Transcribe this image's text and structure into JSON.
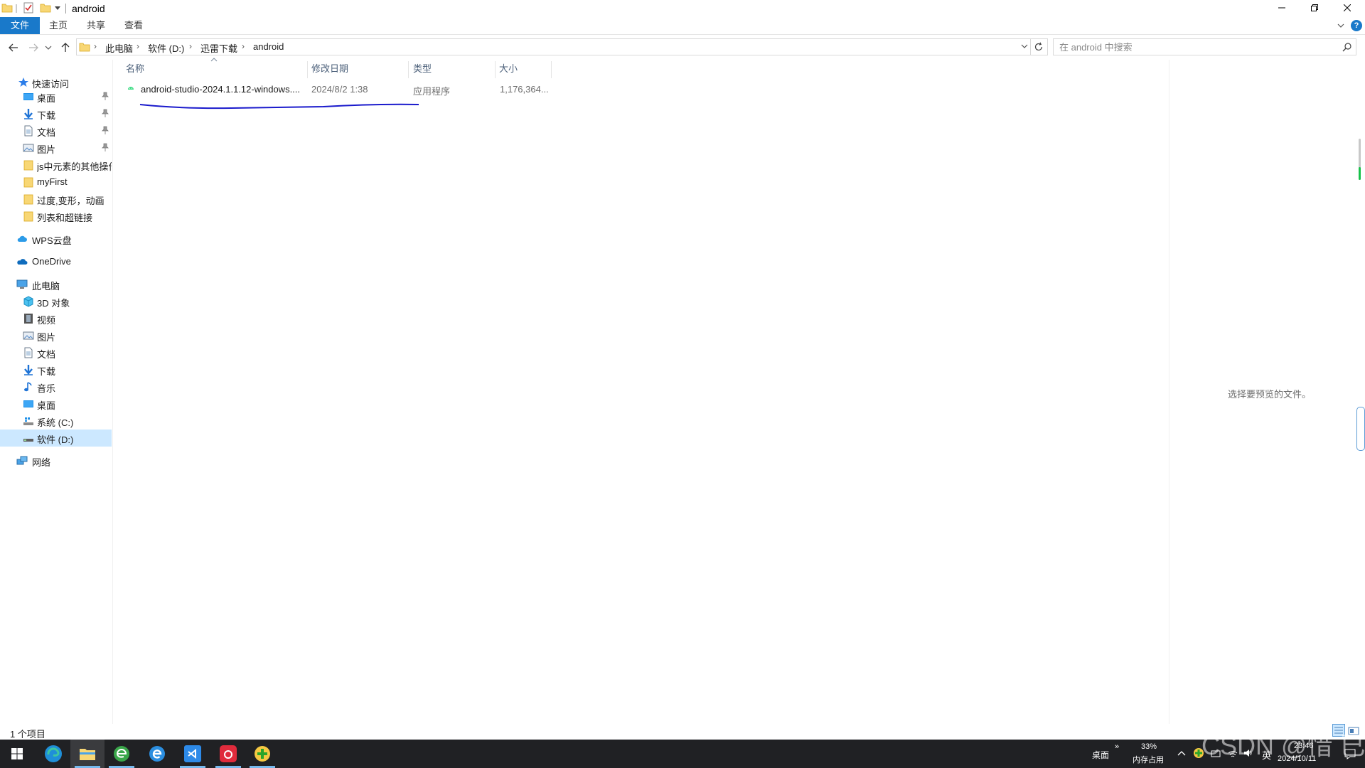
{
  "window": {
    "title": "android"
  },
  "ribbon": {
    "tabs": [
      "文件",
      "主页",
      "共享",
      "查看"
    ]
  },
  "address": {
    "crumbs": [
      "此电脑",
      "软件 (D:)",
      "迅雷下载",
      "android"
    ]
  },
  "search": {
    "placeholder": "在 android 中搜索"
  },
  "sidebar": {
    "quick_access": "快速访问",
    "quick_items": [
      "桌面",
      "下载",
      "文档",
      "图片",
      "js中元素的其他操作",
      "myFirst",
      "过度,变形，动画",
      "列表和超链接"
    ],
    "wps": "WPS云盘",
    "onedrive": "OneDrive",
    "this_pc": "此电脑",
    "pc_items": [
      "3D 对象",
      "视频",
      "图片",
      "文档",
      "下载",
      "音乐",
      "桌面",
      "系统 (C:)",
      "软件 (D:)"
    ],
    "network": "网络"
  },
  "columns": [
    "名称",
    "修改日期",
    "类型",
    "大小"
  ],
  "files": [
    {
      "name": "android-studio-2024.1.1.12-windows....",
      "date": "2024/8/2 1:38",
      "type": "应用程序",
      "size": "1,176,364..."
    }
  ],
  "preview": {
    "empty_text": "选择要预览的文件。"
  },
  "status": {
    "count": "1 个项目"
  },
  "taskbar": {
    "desktop_label": "桌面",
    "mem_percent": "33%",
    "mem_label": "内存占用",
    "ime": "英",
    "time": "23:46",
    "date": "2024/10/11",
    "watermark": "CSDN @惜 已"
  },
  "colors": {
    "accent": "#1979ca",
    "selected_bg": "#cce8ff",
    "taskbar_bg": "#202124",
    "annotation_line": "#1a1acc"
  }
}
